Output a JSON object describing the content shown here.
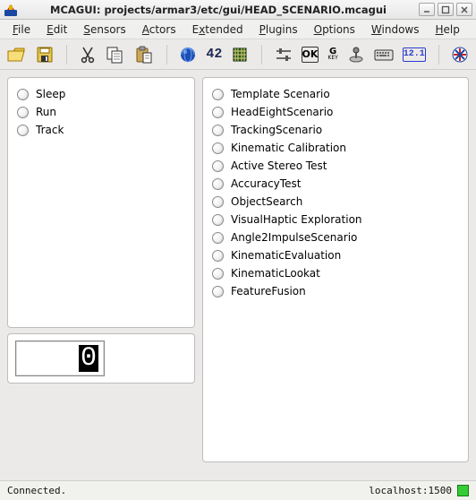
{
  "window": {
    "title": "MCAGUI: projects/armar3/etc/gui/HEAD_SCENARIO.mcagui"
  },
  "menu": {
    "items": [
      {
        "label": "File",
        "mn": "F"
      },
      {
        "label": "Edit",
        "mn": "E"
      },
      {
        "label": "Sensors",
        "mn": "S"
      },
      {
        "label": "Actors",
        "mn": "A"
      },
      {
        "label": "Extended",
        "mn": "x"
      },
      {
        "label": "Plugins",
        "mn": "P"
      },
      {
        "label": "Options",
        "mn": "O"
      },
      {
        "label": "Windows",
        "mn": "W"
      },
      {
        "label": "Help",
        "mn": "H"
      }
    ]
  },
  "toolbar": {
    "icons": [
      "open-icon",
      "save-icon",
      "cut-icon",
      "copy-icon",
      "paste-icon",
      "separator",
      "globe-icon",
      "fortytwo-icon",
      "chip-icon",
      "separator",
      "sliders-icon",
      "ok-icon",
      "gkey-icon",
      "joystick-icon",
      "keyboard-icon",
      "display12-icon",
      "separator",
      "asterisk-icon"
    ],
    "fortytwo_label": "42",
    "ok_label": "OK",
    "gkey_line1": "G",
    "gkey_line2": "KEY",
    "display12_label": "12.1"
  },
  "left_options": [
    {
      "label": "Sleep"
    },
    {
      "label": "Run"
    },
    {
      "label": "Track"
    }
  ],
  "digit_value": "0",
  "right_options": [
    {
      "label": "Template Scenario"
    },
    {
      "label": "HeadEightScenario"
    },
    {
      "label": "TrackingScenario"
    },
    {
      "label": "Kinematic Calibration"
    },
    {
      "label": "Active Stereo Test"
    },
    {
      "label": "AccuracyTest"
    },
    {
      "label": "ObjectSearch"
    },
    {
      "label": "VisualHaptic Exploration"
    },
    {
      "label": "Angle2ImpulseScenario"
    },
    {
      "label": "KinematicEvaluation"
    },
    {
      "label": "KinematicLookat"
    },
    {
      "label": "FeatureFusion"
    }
  ],
  "status": {
    "left": "Connected.",
    "right": "localhost:1500"
  }
}
